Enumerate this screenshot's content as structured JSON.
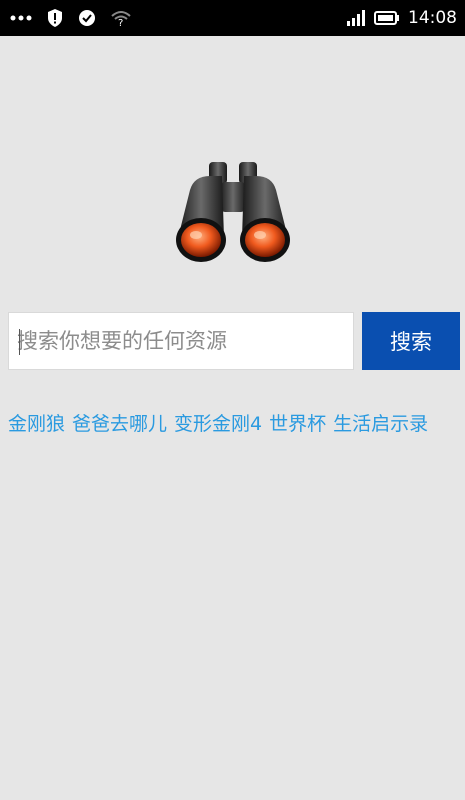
{
  "status_bar": {
    "time": "14:08",
    "icons": [
      "more-dots-icon",
      "shield-alert-icon",
      "check-circle-icon",
      "wifi-question-icon",
      "signal-icon",
      "battery-icon"
    ]
  },
  "logo": {
    "icon": "binoculars-icon"
  },
  "search": {
    "placeholder": "搜索你想要的任何资源",
    "value": "",
    "button_label": "搜索"
  },
  "hot_links": [
    {
      "label": "金刚狼"
    },
    {
      "label": "爸爸去哪儿"
    },
    {
      "label": "变形金刚4"
    },
    {
      "label": "世界杯"
    },
    {
      "label": "生活启示录"
    }
  ],
  "colors": {
    "background": "#e6e6e6",
    "status_bar": "#000000",
    "button": "#0a4fb0",
    "link": "#2a9ae0"
  }
}
